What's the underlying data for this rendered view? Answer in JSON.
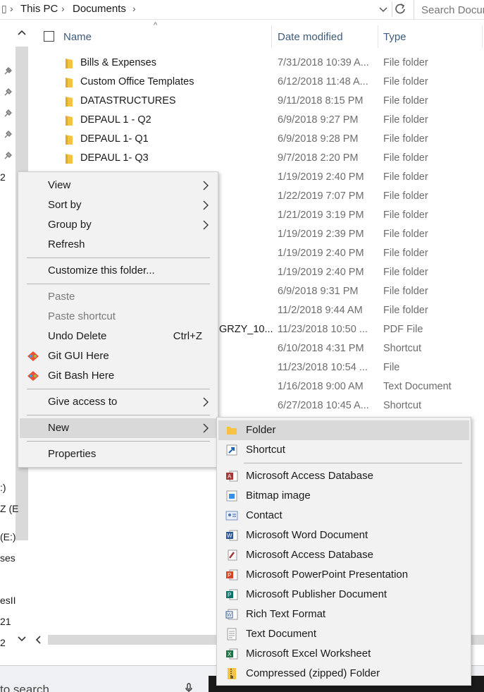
{
  "address": {
    "crumbs": [
      "This PC",
      "Documents"
    ],
    "search_placeholder": "Search Documents"
  },
  "columns": {
    "name": "Name",
    "date": "Date modified",
    "type": "Type"
  },
  "files": [
    {
      "name": "Bills & Expenses",
      "date": "7/31/2018 10:39 A...",
      "type": "File folder",
      "icon": "folder-icon"
    },
    {
      "name": "Custom Office Templates",
      "date": "6/12/2018 11:48 A...",
      "type": "File folder",
      "icon": "folder-icon"
    },
    {
      "name": "DATASTRUCTURES",
      "date": "9/11/2018 8:15 PM",
      "type": "File folder",
      "icon": "folder-icon"
    },
    {
      "name": "DEPAUL 1 - Q2",
      "date": "6/9/2018 9:27 PM",
      "type": "File folder",
      "icon": "folder-icon"
    },
    {
      "name": "DEPAUL 1- Q1",
      "date": "6/9/2018 9:28 PM",
      "type": "File folder",
      "icon": "folder-icon"
    },
    {
      "name": "DEPAUL 1- Q3",
      "date": "9/7/2018 2:20 PM",
      "type": "File folder",
      "icon": "folder-icon"
    },
    {
      "name": "",
      "date": "1/19/2019 2:40 PM",
      "type": "File folder"
    },
    {
      "name": "",
      "date": "1/22/2019 7:07 PM",
      "type": "File folder"
    },
    {
      "name": "",
      "date": "1/21/2019 3:19 PM",
      "type": "File folder"
    },
    {
      "name": "",
      "date": "1/19/2019 2:39 PM",
      "type": "File folder"
    },
    {
      "name": "",
      "date": "1/19/2019 2:40 PM",
      "type": "File folder"
    },
    {
      "name": "",
      "date": "1/19/2019 2:40 PM",
      "type": "File folder"
    },
    {
      "name": "",
      "date": "6/9/2018 9:31 PM",
      "type": "File folder"
    },
    {
      "name": "",
      "date": "11/2/2018 9:44 AM",
      "type": "File folder"
    },
    {
      "name": "GRZY_10...",
      "date": "11/23/2018 10:50 ...",
      "type": "PDF File"
    },
    {
      "name": "",
      "date": "6/10/2018 4:31 PM",
      "type": "Shortcut"
    },
    {
      "name": "",
      "date": "11/23/2018 10:54 ...",
      "type": "File"
    },
    {
      "name": "",
      "date": "1/16/2018 9:00 AM",
      "type": "Text Document"
    },
    {
      "name": "",
      "date": "6/27/2018 10:45 A...",
      "type": "Shortcut"
    }
  ],
  "nav_fragments": [
    "2",
    ":)",
    "Z (E",
    "(E:)",
    "ses",
    "esII",
    "21",
    "2"
  ],
  "context_menu": {
    "view": "View",
    "sort_by": "Sort by",
    "group_by": "Group by",
    "refresh": "Refresh",
    "customize": "Customize this folder...",
    "paste": "Paste",
    "paste_shortcut": "Paste shortcut",
    "undo_delete": "Undo Delete",
    "undo_shortcut": "Ctrl+Z",
    "git_gui": "Git GUI Here",
    "git_bash": "Git Bash Here",
    "give_access": "Give access to",
    "new": "New",
    "properties": "Properties"
  },
  "new_submenu": [
    {
      "label": "Folder",
      "icon": "folder-icon"
    },
    {
      "label": "Shortcut",
      "icon": "shortcut-icon"
    },
    {
      "label": "Microsoft Access Database",
      "icon": "access-icon"
    },
    {
      "label": "Bitmap image",
      "icon": "bitmap-icon"
    },
    {
      "label": "Contact",
      "icon": "contact-icon"
    },
    {
      "label": "Microsoft Word Document",
      "icon": "word-icon"
    },
    {
      "label": "Microsoft Access Database",
      "icon": "access-icon"
    },
    {
      "label": "Microsoft PowerPoint Presentation",
      "icon": "powerpoint-icon"
    },
    {
      "label": "Microsoft Publisher Document",
      "icon": "publisher-icon"
    },
    {
      "label": "Rich Text Format",
      "icon": "rtf-icon"
    },
    {
      "label": "Text Document",
      "icon": "text-document-icon"
    },
    {
      "label": "Microsoft Excel Worksheet",
      "icon": "excel-icon"
    },
    {
      "label": "Compressed (zipped) Folder",
      "icon": "zip-folder-icon"
    }
  ],
  "taskbar": {
    "search_text": "to search"
  },
  "colors": {
    "folder": "#f5c242",
    "menu_bg": "#f2f2f2",
    "highlight": "#d9d9d9",
    "header_text": "#3e5a7a"
  }
}
